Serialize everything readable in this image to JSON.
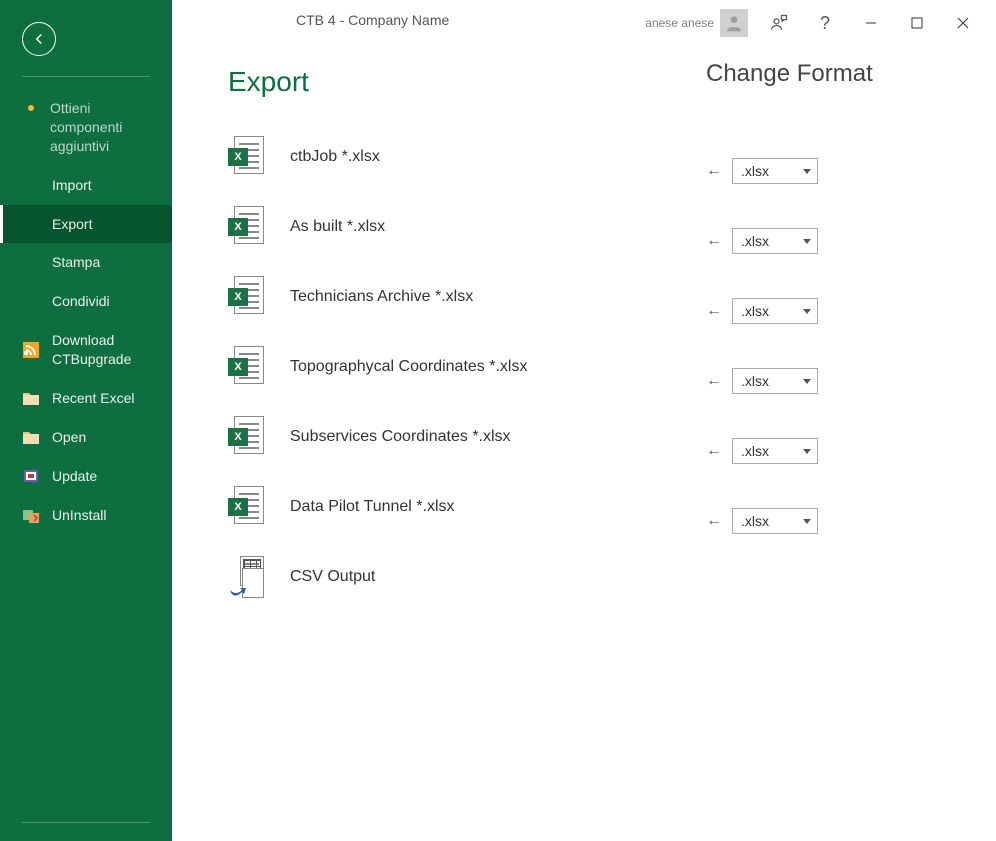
{
  "titlebar": {
    "app_title": "CTB 4  -  Company Name",
    "user_name": "anese anese"
  },
  "sidebar": {
    "addins_label": "Ottieni componenti aggiuntivi",
    "items": [
      {
        "label": "Import"
      },
      {
        "label": "Export"
      },
      {
        "label": "Stampa"
      },
      {
        "label": "Condividi"
      }
    ],
    "tools": [
      {
        "label": "Download CTBupgrade"
      },
      {
        "label": "Recent Excel"
      },
      {
        "label": "Open"
      },
      {
        "label": "Update"
      },
      {
        "label": "UnInstall"
      }
    ]
  },
  "main": {
    "title": "Export",
    "rows": [
      {
        "label": "ctbJob  *.xlsx"
      },
      {
        "label": "As built  *.xlsx"
      },
      {
        "label": "Technicians Archive  *.xlsx"
      },
      {
        "label": "Topographycal Coordinates  *.xlsx"
      },
      {
        "label": "Subservices Coordinates  *.xlsx"
      },
      {
        "label": "Data Pilot Tunnel  *.xlsx"
      },
      {
        "label": "CSV Output"
      }
    ]
  },
  "format": {
    "title": "Change Format",
    "arrow": "←",
    "options": [
      {
        "value": ".xlsx"
      },
      {
        "value": ".xlsx"
      },
      {
        "value": ".xlsx"
      },
      {
        "value": ".xlsx"
      },
      {
        "value": ".xlsx"
      },
      {
        "value": ".xlsx"
      }
    ]
  }
}
